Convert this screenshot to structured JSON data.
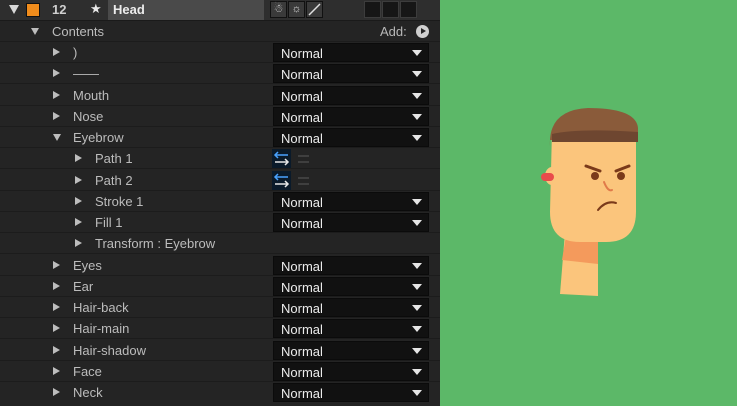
{
  "layer": {
    "number": "12",
    "name": "Head",
    "label_color": "#f08c1c"
  },
  "contents": {
    "label": "Contents",
    "add_label": "Add:"
  },
  "rows": [
    {
      "name": ")",
      "blend": "Normal"
    },
    {
      "name": "——",
      "blend": "Normal"
    },
    {
      "name": "Mouth",
      "blend": "Normal"
    },
    {
      "name": "Nose",
      "blend": "Normal"
    },
    {
      "name": "Eyebrow",
      "blend": "Normal"
    },
    {
      "name": "Path 1"
    },
    {
      "name": "Path 2"
    },
    {
      "name": "Stroke 1",
      "blend": "Normal"
    },
    {
      "name": "Fill 1",
      "blend": "Normal"
    },
    {
      "name": "Transform : Eyebrow"
    },
    {
      "name": "Eyes",
      "blend": "Normal"
    },
    {
      "name": "Ear",
      "blend": "Normal"
    },
    {
      "name": "Hair-back",
      "blend": "Normal"
    },
    {
      "name": "Hair-main",
      "blend": "Normal"
    },
    {
      "name": "Hair-shadow",
      "blend": "Normal"
    },
    {
      "name": "Face",
      "blend": "Normal"
    },
    {
      "name": "Neck",
      "blend": "Normal"
    }
  ],
  "colors": {
    "canvas_bg": "#5cb868",
    "panel_bg": "#242424",
    "skin": "#fbc57c",
    "hair": "#8a5b3a",
    "blush": "#e94b4b",
    "neck_shadow": "#f49a5c"
  }
}
